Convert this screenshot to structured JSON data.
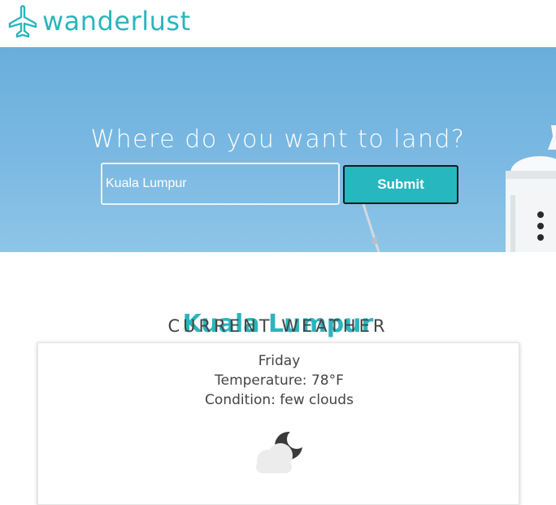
{
  "brand": {
    "name": "wanderlust",
    "icon": "airplane-icon",
    "color": "#2bb5bd"
  },
  "hero": {
    "title": "Where do you want to land?",
    "search_value": "Kuala Lumpur",
    "submit_label": "Submit",
    "submit_color": "#26b7bf"
  },
  "weather": {
    "city": "Kuala Lumpur",
    "subtitle": "CURRENT WEATHER",
    "day": "Friday",
    "temperature": "Temperature: 78°F",
    "condition": "Condition: few clouds",
    "icon": "few-clouds-night-icon"
  }
}
